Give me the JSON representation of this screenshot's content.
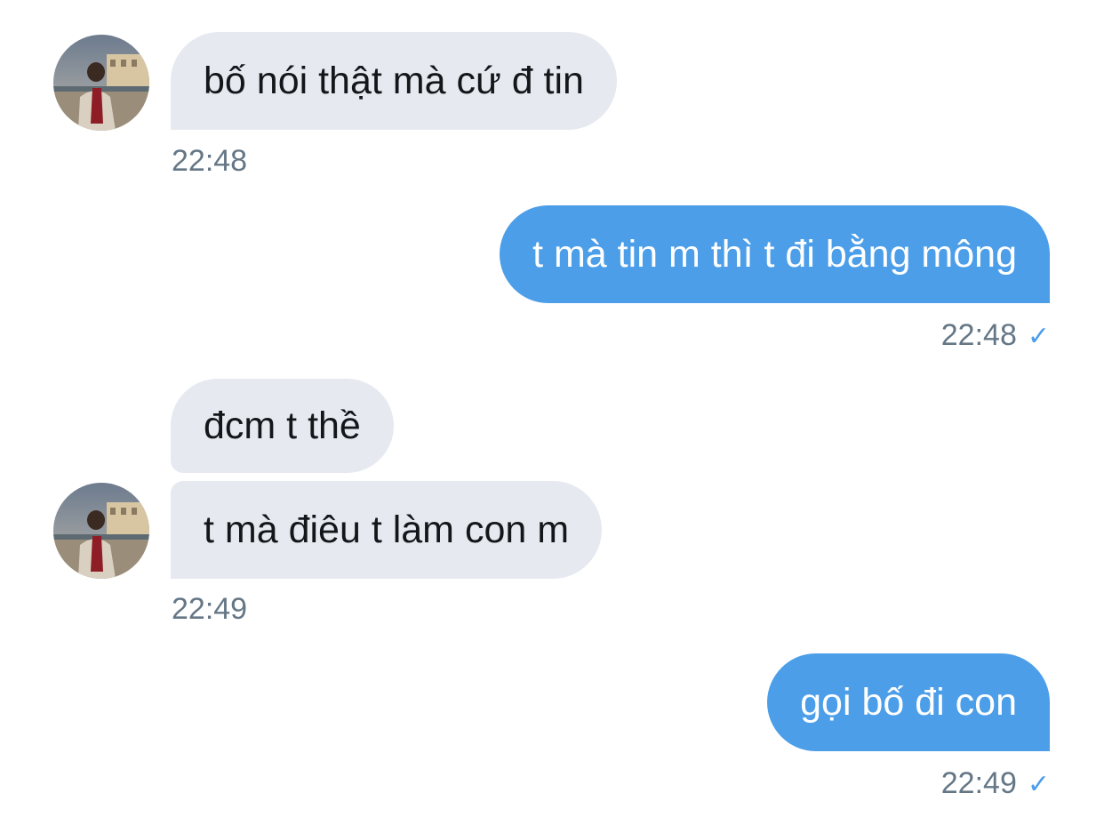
{
  "messages": [
    {
      "text": "bố nói thật mà cứ đ tin"
    },
    {
      "text": "t mà tin m thì t đi bằng mông"
    },
    {
      "text": "đcm t thề"
    },
    {
      "text": "t mà điêu t làm con m"
    },
    {
      "text": "gọi bố đi con"
    }
  ],
  "timestamps": {
    "t1": "22:48",
    "t2": "22:48",
    "t3": "22:49",
    "t4": "22:49"
  },
  "icons": {
    "read_receipt": "check-icon",
    "avatar": "contact-avatar"
  },
  "colors": {
    "incoming_bubble": "#e6e9ef",
    "outgoing_bubble": "#4c9ee9",
    "timestamp": "#657786",
    "checkmark": "#4c9ee9"
  },
  "check_glyph": "✓"
}
